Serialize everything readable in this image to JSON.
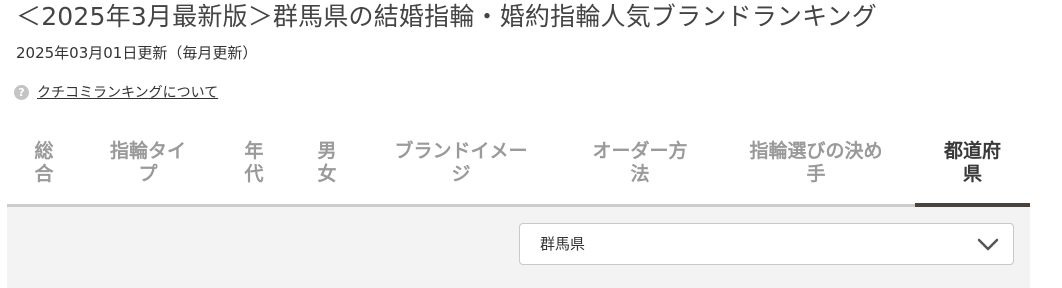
{
  "page": {
    "title": "＜2025年3月最新版＞群馬県の結婚指輪・婚約指輪人気ブランドランキング",
    "updated": "2025年03月01日更新（毎月更新）",
    "about_link": "クチコミランキングについて",
    "help_icon_glyph": "?"
  },
  "tabs": [
    {
      "lines": [
        "総",
        "合"
      ]
    },
    {
      "lines": [
        "指輪タイ",
        "プ"
      ]
    },
    {
      "lines": [
        "年",
        "代"
      ]
    },
    {
      "lines": [
        "男",
        "女"
      ]
    },
    {
      "lines": [
        "ブランドイメー",
        "ジ"
      ]
    },
    {
      "lines": [
        "オーダー方",
        "法"
      ]
    },
    {
      "lines": [
        "指輪選びの決め",
        "手"
      ]
    },
    {
      "lines": [
        "都道府",
        "県"
      ],
      "active": true
    }
  ],
  "prefecture_select": {
    "selected": "群馬県",
    "icon": "chevron-down-icon"
  },
  "colors": {
    "active_tab_text": "#3a3a3a",
    "inactive_tab_text": "#9a9a9a",
    "active_underline": "#4a423c",
    "panel_bg": "#f3f3f3"
  }
}
